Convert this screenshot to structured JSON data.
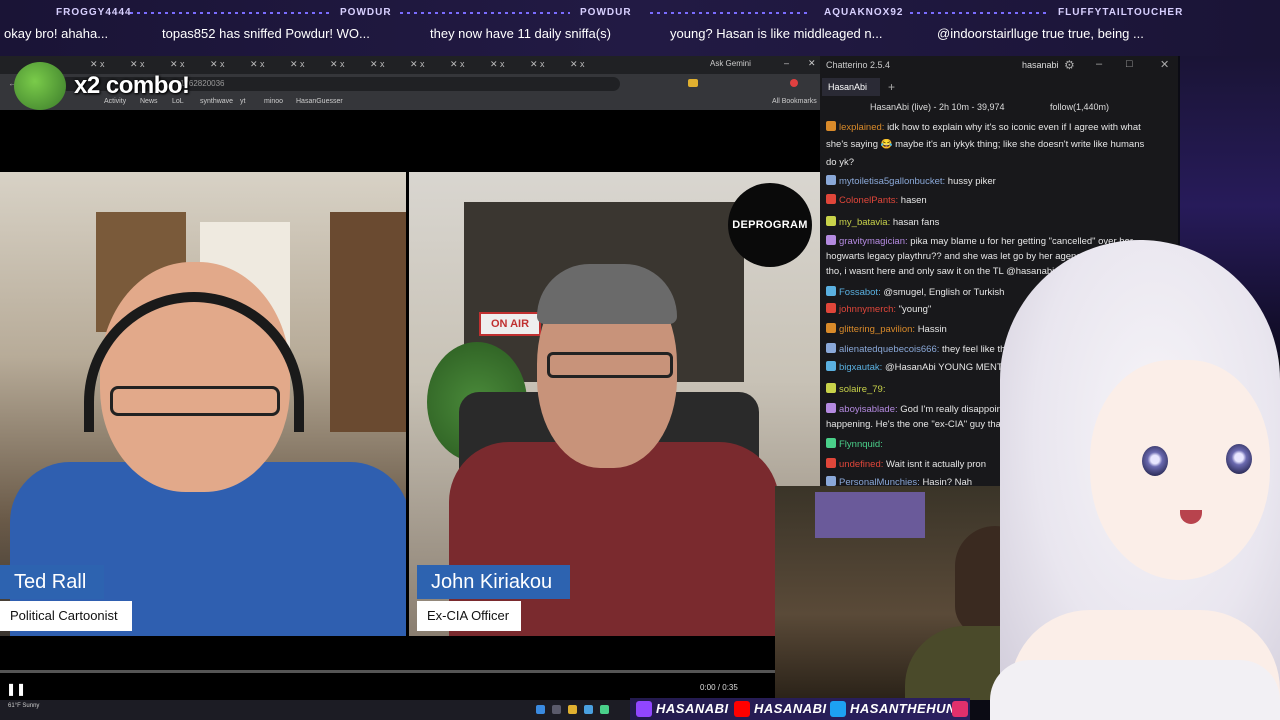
{
  "ticker": [
    {
      "user": "FROGGY4444",
      "message": "okay bro! ahaha..."
    },
    {
      "user": "POWDUR",
      "message": "topas852 has sniffed Powdur! WO..."
    },
    {
      "user": "POWDUR",
      "message": "they now have 11 daily sniffa(s)"
    },
    {
      "user": "AQUAKNOX92",
      "message": "young? Hasan is like middleaged n..."
    },
    {
      "user": "FLUFFYTAILTOUCHER",
      "message": "@indoorstairlluge true true, being ..."
    }
  ],
  "browser": {
    "url": "1762820036",
    "bookmarks": [
      "Activity",
      "News",
      "LoL",
      "synthwave",
      "yt",
      "minoo",
      "HasanGuesser"
    ],
    "all_bookmarks": "All Bookmarks",
    "ask_gemini": "Ask Gemini"
  },
  "combo": {
    "text": "x2 combo!"
  },
  "video": {
    "left_name": "Ted Rall",
    "left_title": "Political Cartoonist",
    "right_name": "John Kiriakou",
    "right_title": "Ex-CIA Officer",
    "logo_text": "DEPROGRAM",
    "sign_text": "ON AIR",
    "time": "0:00 / 0:35"
  },
  "taskbar": {
    "weather": "61°F Sunny"
  },
  "chat": {
    "app_title": "Chatterino 2.5.4",
    "user": "hasanabi",
    "tab": "HasanAbi",
    "status": "HasanAbi (live) - 2h 10m - 39,974",
    "follow": "follow(1,440m)",
    "messages": [
      {
        "user": "lexplained:",
        "color": "#d98a2a",
        "text": "idk how to explain why it's so iconic even if I agree with what"
      },
      {
        "user": "",
        "color": "#e6e6e6",
        "text": "she's saying 😂 maybe it's an iykyk thing; like she doesn't write like humans"
      },
      {
        "user": "",
        "color": "#e6e6e6",
        "text": "do yk?"
      },
      {
        "user": "mytoiletisa5gallonbucket:",
        "color": "#8aa8d8",
        "text": "hussy piker"
      },
      {
        "user": "ColonelPants:",
        "color": "#e0463a",
        "text": "hasen"
      },
      {
        "user": "my_batavia:",
        "color": "#c8d24a",
        "text": "hasan fans"
      },
      {
        "user": "gravitymagician:",
        "color": "#b48ae0",
        "text": "pika may blame u for her getting \"cancelled\" over her"
      },
      {
        "user": "",
        "color": "#e6e6e6",
        "text": "hogwarts legacy playthru?? and she was let go by her agency. idk if"
      },
      {
        "user": "",
        "color": "#e6e6e6",
        "text": "tho, i wasnt here and only saw it on the TL @hasanabi"
      },
      {
        "user": "Fossabot:",
        "color": "#5ab0e0",
        "text": "@smugel, English or Turkish"
      },
      {
        "user": "johnnymerch:",
        "color": "#e0463a",
        "text": "\"young\""
      },
      {
        "user": "glittering_pavilion:",
        "color": "#d98a2a",
        "text": "Hassin"
      },
      {
        "user": "alienatedquebecois666:",
        "color": "#8aa8d8",
        "text": "they feel like they"
      },
      {
        "user": "bigxautak:",
        "color": "#5ab0e0",
        "text": "@HasanAbi YOUNG MENTIONED"
      },
      {
        "user": "solaire_79:",
        "color": "#c8d24a",
        "text": ""
      },
      {
        "user": "aboyisablade:",
        "color": "#b48ae0",
        "text": "God I'm really disappoint"
      },
      {
        "user": "",
        "color": "#e6e6e6",
        "text": "happening. He's the one \"ex-CIA\" guy that"
      },
      {
        "user": "Flynnquid:",
        "color": "#4ad08a",
        "text": ""
      },
      {
        "user": "undefined:",
        "color": "#e0463a",
        "text": "Wait isnt it actually pron"
      },
      {
        "user": "PersonalMunchies:",
        "color": "#8aa8d8",
        "text": "Hasin? Nah"
      }
    ]
  },
  "socials": [
    {
      "icon": "twitch-icon",
      "label": "HASANABI",
      "color": "#9146ff"
    },
    {
      "icon": "youtube-icon",
      "label": "HASANABI",
      "color": "#ff0000"
    },
    {
      "icon": "twitter-icon",
      "label": "HASANTHEHUN",
      "color": "#1da1f2"
    },
    {
      "icon": "instagram-icon",
      "label": "",
      "color": "#e1306c"
    }
  ]
}
